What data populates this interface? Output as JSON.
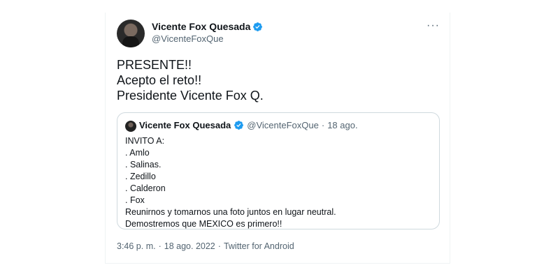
{
  "author": {
    "name": "Vicente Fox Quesada",
    "handle": "@VicenteFoxQue"
  },
  "more_glyph": "···",
  "tweet_lines": [
    "PRESENTE!!",
    "Acepto el reto!!",
    "Presidente Vicente Fox Q."
  ],
  "quote": {
    "name": "Vicente Fox Quesada",
    "handle": "@VicenteFoxQue",
    "separator": "·",
    "date": "18 ago.",
    "lines": [
      "INVITO A:",
      ". Amlo",
      ". Salinas.",
      ". Zedillo",
      ". Calderon",
      ". Fox",
      "Reunirnos y tomarnos una foto juntos en lugar neutral.",
      "Demostremos que MEXICO es primero!!"
    ]
  },
  "footer": {
    "time": "3:46 p. m.",
    "separator": "·",
    "date": "18 ago. 2022",
    "source": "Twitter for Android"
  },
  "colors": {
    "verified": "#1d9bf0",
    "secondary_text": "#536471",
    "border": "#cfd9de"
  },
  "icons": {
    "verified": "verified-badge-icon",
    "more": "more-options-icon"
  }
}
